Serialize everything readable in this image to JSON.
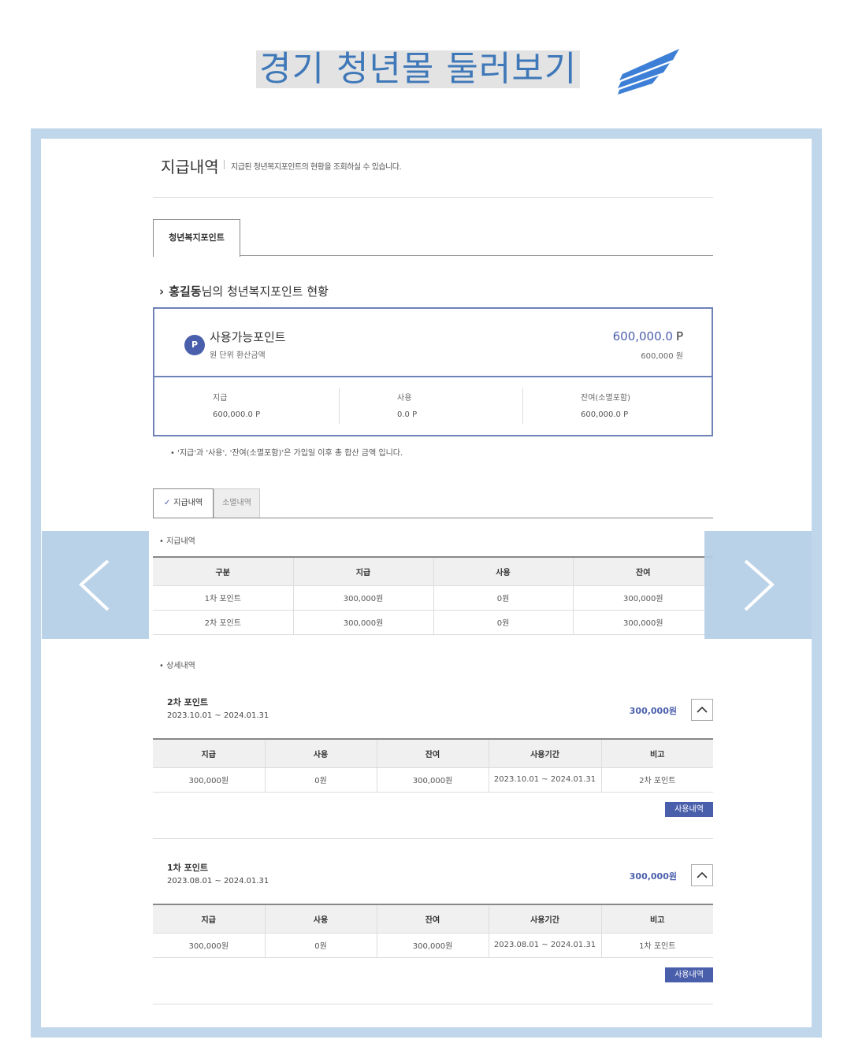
{
  "banner": {
    "title": "경기 청년몰 둘러보기",
    "accent": "#3f78b8"
  },
  "page": {
    "heading": "지급내역",
    "description": "지급된 청년복지포인트의 현황을 조회하실 수 있습니다.",
    "main_tab": "청년복지포인트",
    "status_user": "홍길동",
    "status_suffix": "님의 청년복지포인트 현황"
  },
  "points": {
    "icon": "P",
    "label": "사용가능포인트",
    "sub_label": "원 단위 환산금액",
    "value": "600,000.0",
    "unit": "P",
    "won_value": "600,000 원",
    "stats": [
      {
        "label": "지급",
        "value": "600,000.0 P"
      },
      {
        "label": "사용",
        "value": "0.0 P"
      },
      {
        "label": "잔여(소멸포함)",
        "value": "600,000.0 P"
      }
    ],
    "note": "• '지급'과 '사용', '잔여(소멸포함)'은 가입일 이후 총 합산 금액 입니다."
  },
  "sub_tabs": {
    "active": "지급내역",
    "inactive": "소멸내역"
  },
  "summary": {
    "label": "• 지급내역",
    "headers": [
      "구분",
      "지급",
      "사용",
      "잔여"
    ],
    "rows": [
      [
        "1차 포인트",
        "300,000원",
        "0원",
        "300,000원"
      ],
      [
        "2차 포인트",
        "300,000원",
        "0원",
        "300,000원"
      ]
    ]
  },
  "details": {
    "label": "• 상세내역",
    "headers": [
      "지급",
      "사용",
      "잔여",
      "사용기간",
      "비고"
    ],
    "button": "사용내역",
    "items": [
      {
        "name": "2차 포인트",
        "period": "2023.10.01 ~ 2024.01.31",
        "amount": "300,000원",
        "row": [
          "300,000원",
          "0원",
          "300,000원",
          "2023.10.01 ~ 2024.01.31",
          "2차 포인트"
        ]
      },
      {
        "name": "1차 포인트",
        "period": "2023.08.01 ~ 2024.01.31",
        "amount": "300,000원",
        "row": [
          "300,000원",
          "0원",
          "300,000원",
          "2023.08.01 ~ 2024.01.31",
          "1차 포인트"
        ]
      }
    ]
  },
  "icons": {
    "logo": "wing-logo-icon",
    "prev": "chevron-left-icon",
    "next": "chevron-right-icon",
    "collapse": "chevron-up-icon"
  }
}
